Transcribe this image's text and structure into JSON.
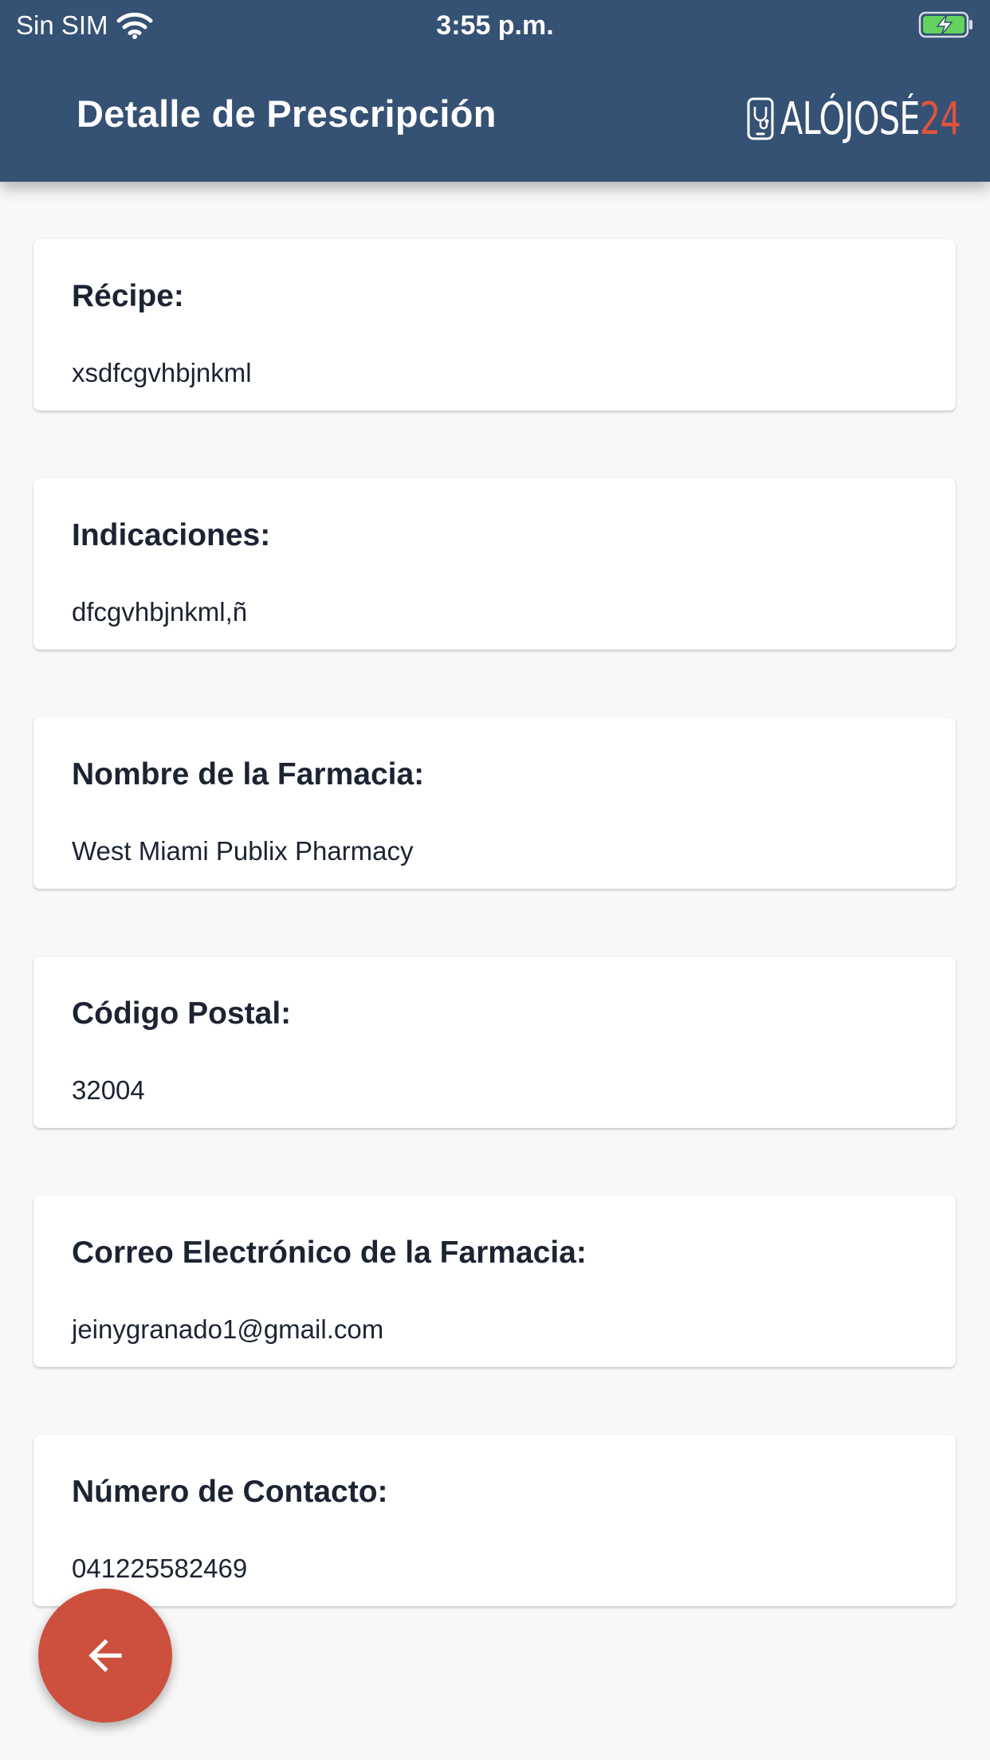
{
  "status_bar": {
    "carrier": "Sin SIM",
    "time": "3:55 p.m.",
    "wifi_icon": "wifi-icon",
    "battery_icon": "battery-charging-icon"
  },
  "header": {
    "title": "Detalle de Prescripción",
    "logo_text": "ALÓJOSÉ",
    "logo_number": "24",
    "background_color": "#355174",
    "logo_accent_color": "#e0533e"
  },
  "cards": [
    {
      "label": "Récipe:",
      "value": "xsdfcgvhbjnkml"
    },
    {
      "label": "Indicaciones:",
      "value": "dfcgvhbjnkml,ñ"
    },
    {
      "label": "Nombre de la Farmacia:",
      "value": "West Miami Publix Pharmacy"
    },
    {
      "label": "Código Postal:",
      "value": "32004"
    },
    {
      "label": "Correo Electrónico de la Farmacia:",
      "value": "jeinygranado1@gmail.com"
    },
    {
      "label": "Número de Contacto:",
      "value": "041225582469"
    }
  ],
  "back_button": {
    "icon": "arrow-left-icon",
    "color": "#cd4f3d"
  }
}
